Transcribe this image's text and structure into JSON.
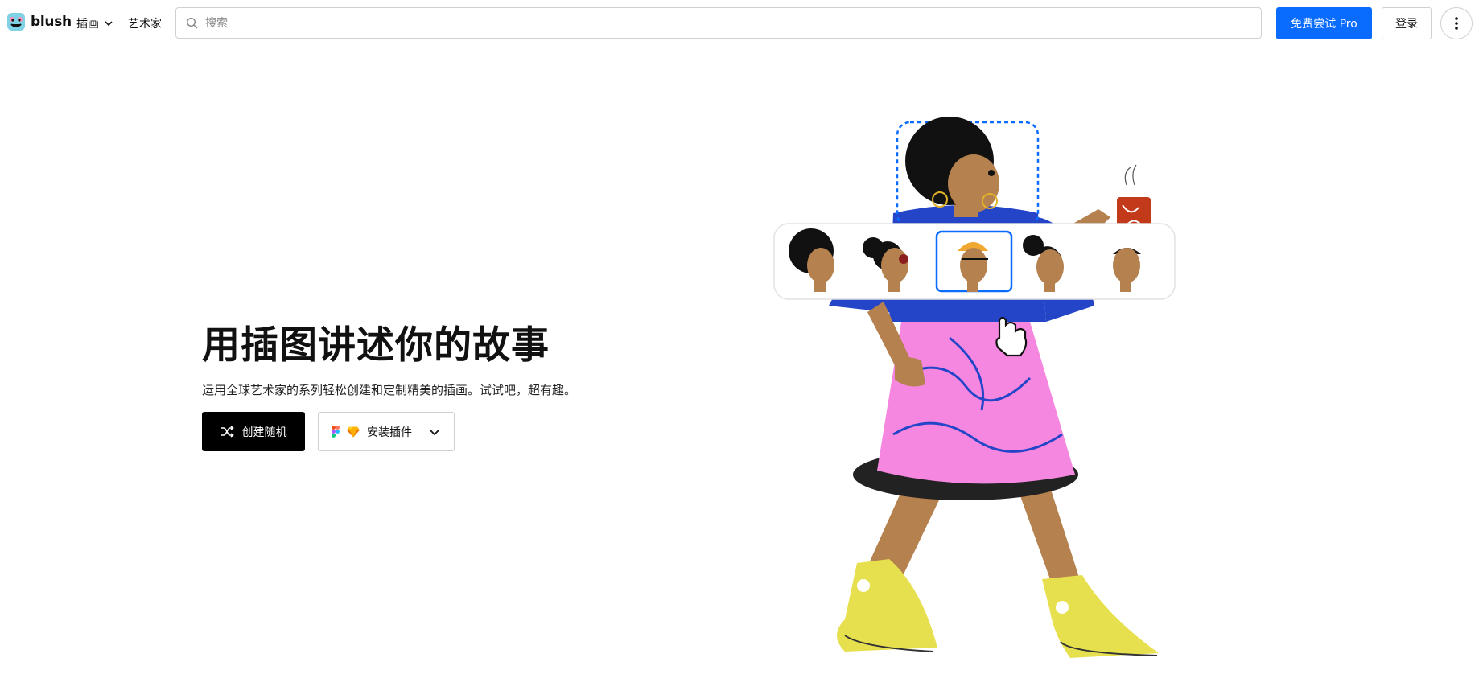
{
  "header": {
    "brand": "blush",
    "nav": [
      {
        "label": "插画",
        "has_dropdown": true
      },
      {
        "label": "艺术家",
        "has_dropdown": false
      }
    ],
    "search_placeholder": "搜索",
    "pro_button": "免费尝试 Pro",
    "login_button": "登录",
    "more_icon": "vertical-dots-icon"
  },
  "hero": {
    "title": "用插图讲述你的故事",
    "subtitle": "运用全球艺术家的系列轻松创建和定制精美的插画。试试吧，超有趣。",
    "random_button": "创建随机",
    "plugin_button": "安装插件"
  },
  "illustration": {
    "head_options_count": 5,
    "selected_head": 3
  },
  "colors": {
    "accent": "#0a6cff",
    "shirt": "#2545c8",
    "skirt": "#f587e0",
    "skin": "#b5814e",
    "shoes": "#e6e04e"
  }
}
